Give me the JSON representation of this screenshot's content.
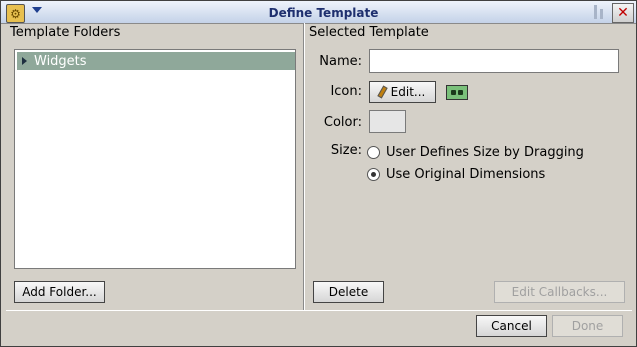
{
  "window": {
    "title": "Define Template"
  },
  "left_panel": {
    "header": "Template Folders",
    "folders": [
      {
        "label": "Widgets",
        "selected": true
      }
    ],
    "add_folder_label": "Add Folder..."
  },
  "right_panel": {
    "header": "Selected Template",
    "name_label": "Name:",
    "name_value": "",
    "icon_label": "Icon:",
    "edit_label": "Edit...",
    "color_label": "Color:",
    "size_label": "Size:",
    "size_options": [
      {
        "label": "User Defines Size by Dragging",
        "checked": false
      },
      {
        "label": "Use Original Dimensions",
        "checked": true
      }
    ],
    "delete_label": "Delete",
    "edit_callbacks_label": "Edit Callbacks..."
  },
  "footer": {
    "cancel_label": "Cancel",
    "done_label": "Done"
  },
  "colors": {
    "title_text": "#1e2f6e",
    "selection": "#8fa89a",
    "dialog_bg": "#d4d0c8",
    "close_x": "#c00000"
  }
}
